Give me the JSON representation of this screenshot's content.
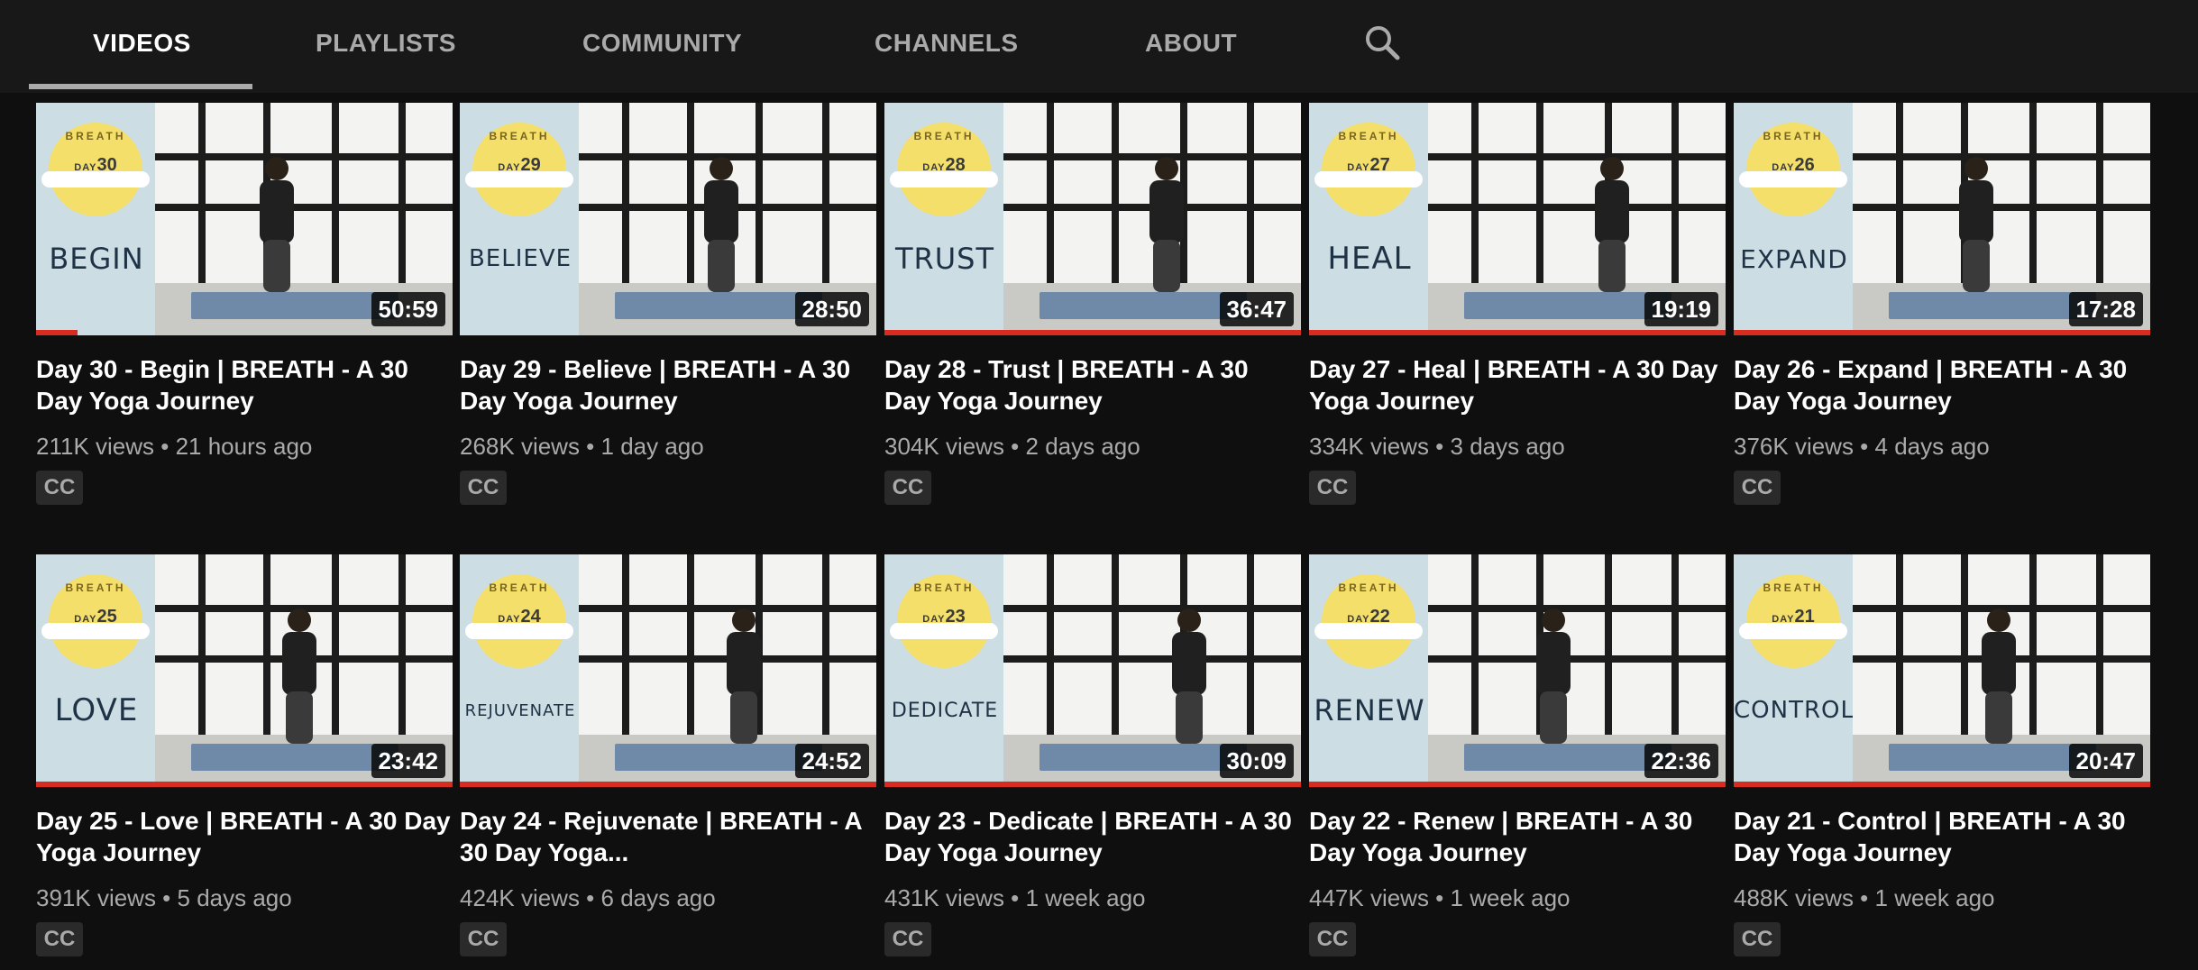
{
  "tabs": [
    {
      "label": "VIDEOS",
      "active": true
    },
    {
      "label": "PLAYLISTS",
      "active": false
    },
    {
      "label": "COMMUNITY",
      "active": false
    },
    {
      "label": "CHANNELS",
      "active": false
    },
    {
      "label": "ABOUT",
      "active": false
    }
  ],
  "search_icon": "search-icon",
  "thumbnail_series_text": "BREATH",
  "day_prefix": "DAY",
  "cc_label": "CC",
  "colors": {
    "progress": "#d82c20",
    "sun": "#f4df6b",
    "panel": "#cddde4"
  },
  "videos": [
    {
      "day": "30",
      "word": "BEGIN",
      "duration": "50:59",
      "title": "Day 30 - Begin | BREATH - A 30 Day Yoga Journey",
      "meta": "211K views • 21 hours ago",
      "watched": 0.1
    },
    {
      "day": "29",
      "word": "BELIEVE",
      "duration": "28:50",
      "title": "Day 29 - Believe | BREATH - A 30 Day Yoga Journey",
      "meta": "268K views • 1 day ago",
      "watched": 0
    },
    {
      "day": "28",
      "word": "TRUST",
      "duration": "36:47",
      "title": "Day 28 - Trust | BREATH - A 30 Day Yoga Journey",
      "meta": "304K views • 2 days ago",
      "watched": 1
    },
    {
      "day": "27",
      "word": "HEAL",
      "duration": "19:19",
      "title": "Day 27 - Heal | BREATH - A 30 Day Yoga Journey",
      "meta": "334K views • 3 days ago",
      "watched": 1
    },
    {
      "day": "26",
      "word": "EXPAND",
      "duration": "17:28",
      "title": "Day 26 - Expand | BREATH - A 30 Day Yoga Journey",
      "meta": "376K views • 4 days ago",
      "watched": 1
    },
    {
      "day": "25",
      "word": "LOVE",
      "duration": "23:42",
      "title": "Day 25 - Love | BREATH - A 30 Day Yoga Journey",
      "meta": "391K views • 5 days ago",
      "watched": 1
    },
    {
      "day": "24",
      "word": "REJUVENATE",
      "duration": "24:52",
      "title": "Day 24 - Rejuvenate | BREATH - A 30 Day Yoga...",
      "meta": "424K views • 6 days ago",
      "watched": 1
    },
    {
      "day": "23",
      "word": "DEDICATE",
      "duration": "30:09",
      "title": "Day 23 - Dedicate | BREATH - A 30 Day Yoga Journey",
      "meta": "431K views • 1 week ago",
      "watched": 1
    },
    {
      "day": "22",
      "word": "RENEW",
      "duration": "22:36",
      "title": "Day 22 - Renew | BREATH - A 30 Day Yoga Journey",
      "meta": "447K views • 1 week ago",
      "watched": 1
    },
    {
      "day": "21",
      "word": "CONTROL",
      "duration": "20:47",
      "title": "Day 21 - Control | BREATH - A 30 Day Yoga Journey",
      "meta": "488K views • 1 week ago",
      "watched": 1
    }
  ]
}
